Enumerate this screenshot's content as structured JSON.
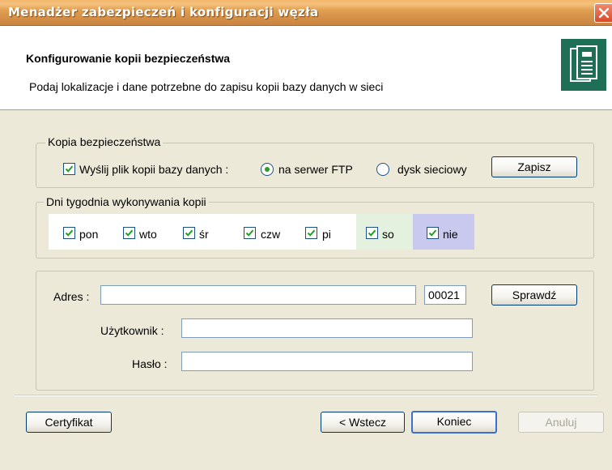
{
  "window": {
    "title": "Menadżer zabezpieczeń i konfiguracji węzła"
  },
  "header": {
    "title": "Konfigurowanie kopii bezpieczeństwa",
    "description": "Podaj lokalizacje i dane potrzebne do zapisu kopii bazy danych w sieci",
    "icon": "document-clipboard-icon"
  },
  "backup_group": {
    "legend": "Kopia bezpieczeństwa",
    "send_checkbox_label": "Wyślij plik kopii bazy danych :",
    "send_checked": true,
    "radio_ftp_label": "na serwer FTP",
    "radio_ftp_selected": true,
    "radio_network_label": "dysk sieciowy",
    "radio_network_selected": false,
    "save_button": "Zapisz"
  },
  "days_group": {
    "legend": "Dni tygodnia wykonywania kopii",
    "days": [
      {
        "label": "pon",
        "checked": true
      },
      {
        "label": "wto",
        "checked": true
      },
      {
        "label": "śr",
        "checked": true
      },
      {
        "label": "czw",
        "checked": true
      },
      {
        "label": "pi",
        "checked": true
      },
      {
        "label": "so",
        "checked": true
      },
      {
        "label": "nie",
        "checked": true
      }
    ]
  },
  "server_group": {
    "address_label": "Adres :",
    "address_value": "",
    "port_value": "00021",
    "check_button": "Sprawdź",
    "user_label": "Użytkownik :",
    "user_value": "",
    "password_label": "Hasło :",
    "password_value": ""
  },
  "footer": {
    "certificate_button": "Certyfikat",
    "back_button": "< Wstecz",
    "finish_button": "Koniec",
    "cancel_button": "Anuluj"
  }
}
